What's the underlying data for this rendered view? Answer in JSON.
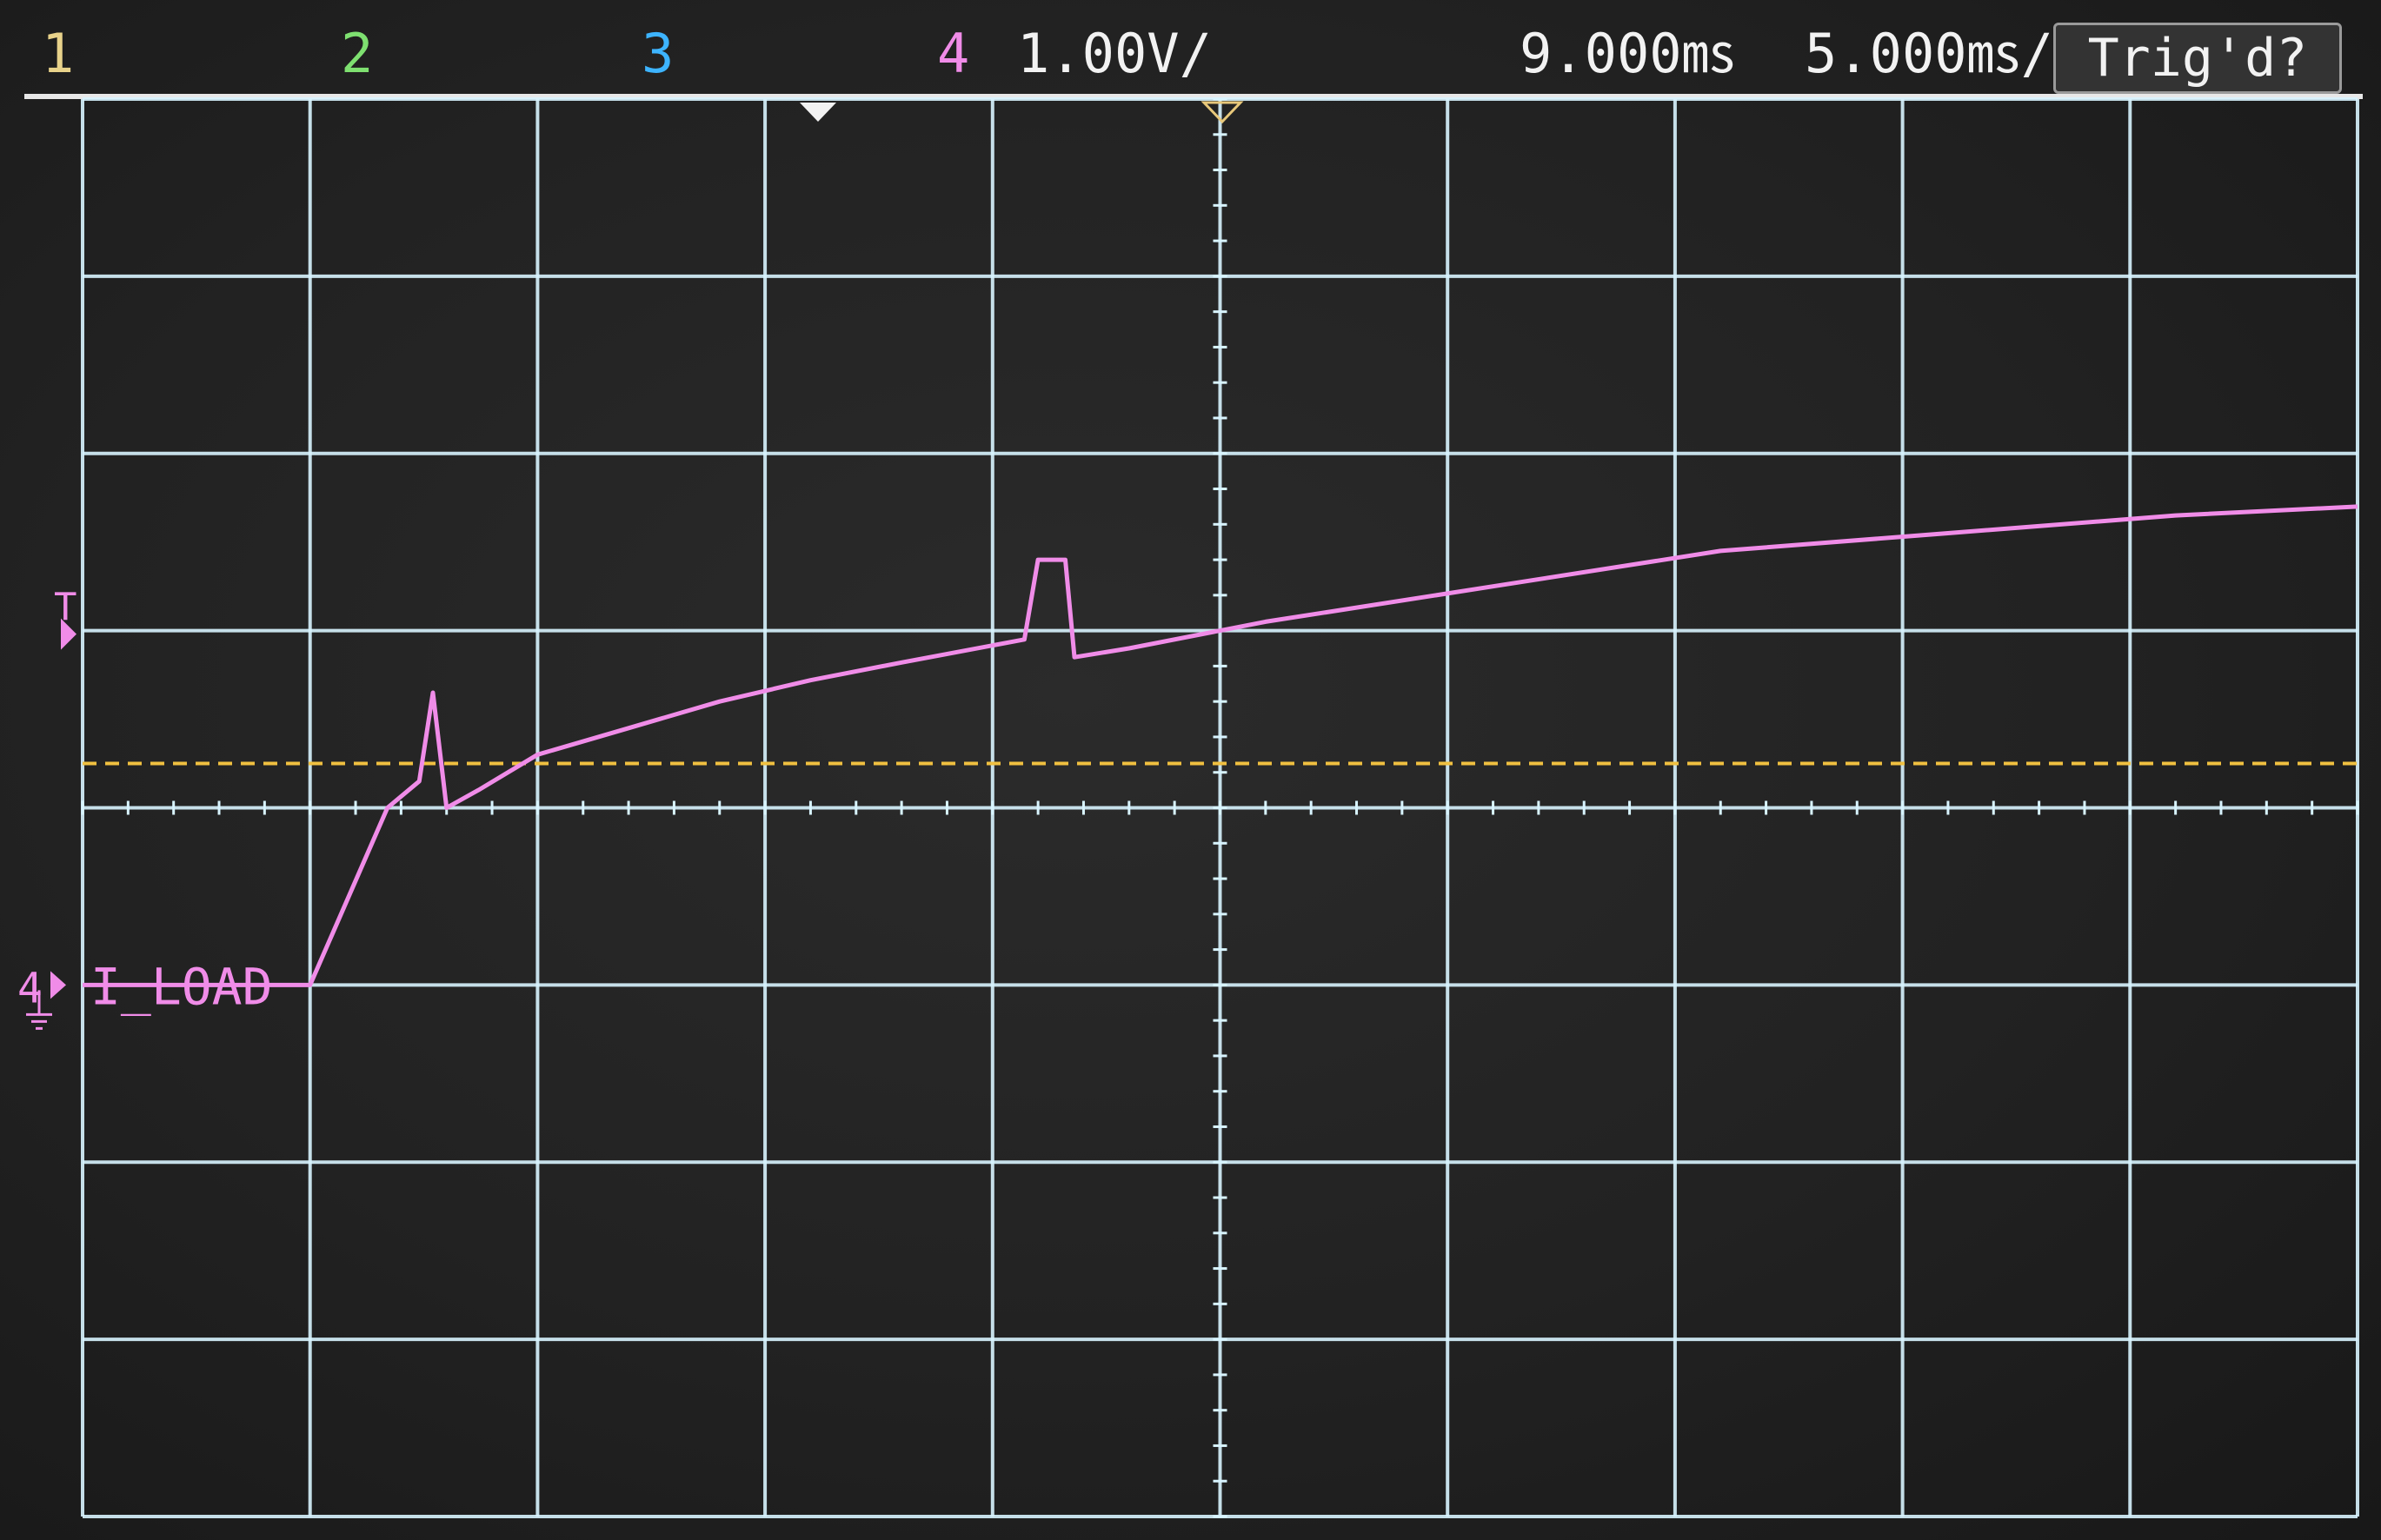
{
  "header": {
    "ch1": "1",
    "ch2": "2",
    "ch3": "3",
    "ch4": "4",
    "vertical_scale": "1.00V/",
    "time_delay": "9.000㎳",
    "time_per_div": "5.000㎳/",
    "trigger_status": "Trig'd?"
  },
  "colors": {
    "channel1": "#e8d28a",
    "channel2": "#7ee070",
    "channel3": "#3db4ff",
    "channel4": "#f08ce8",
    "grid": "#d8f4ff",
    "trigger_level": "#f0c040"
  },
  "chart_data": {
    "type": "line",
    "title": "",
    "xlabel": "",
    "ylabel": "",
    "x_unit": "ms",
    "y_unit": "V",
    "xlim": [
      -16,
      34
    ],
    "ylim": [
      -3,
      5
    ],
    "grid": true,
    "trigger_level_v": 1.25,
    "ground_level_v": 0,
    "series": [
      {
        "name": "I_LOAD",
        "channel": "4",
        "points": [
          [
            -16,
            0
          ],
          [
            -11,
            0
          ],
          [
            -9.3,
            1.0
          ],
          [
            -8.6,
            1.15
          ],
          [
            -8.3,
            1.65
          ],
          [
            -8.0,
            1.0
          ],
          [
            -7.3,
            1.1
          ],
          [
            -6,
            1.3
          ],
          [
            -4,
            1.45
          ],
          [
            -2,
            1.6
          ],
          [
            0,
            1.72
          ],
          [
            2,
            1.82
          ],
          [
            4.7,
            1.95
          ],
          [
            5.0,
            2.4
          ],
          [
            5.6,
            2.4
          ],
          [
            5.8,
            1.85
          ],
          [
            7,
            1.9
          ],
          [
            10,
            2.05
          ],
          [
            15,
            2.25
          ],
          [
            20,
            2.45
          ],
          [
            25,
            2.55
          ],
          [
            30,
            2.65
          ],
          [
            34,
            2.7
          ]
        ]
      }
    ],
    "labels": {
      "trace_label": "I_LOAD",
      "ground_marker": "4",
      "trigger_marker": "T"
    }
  }
}
